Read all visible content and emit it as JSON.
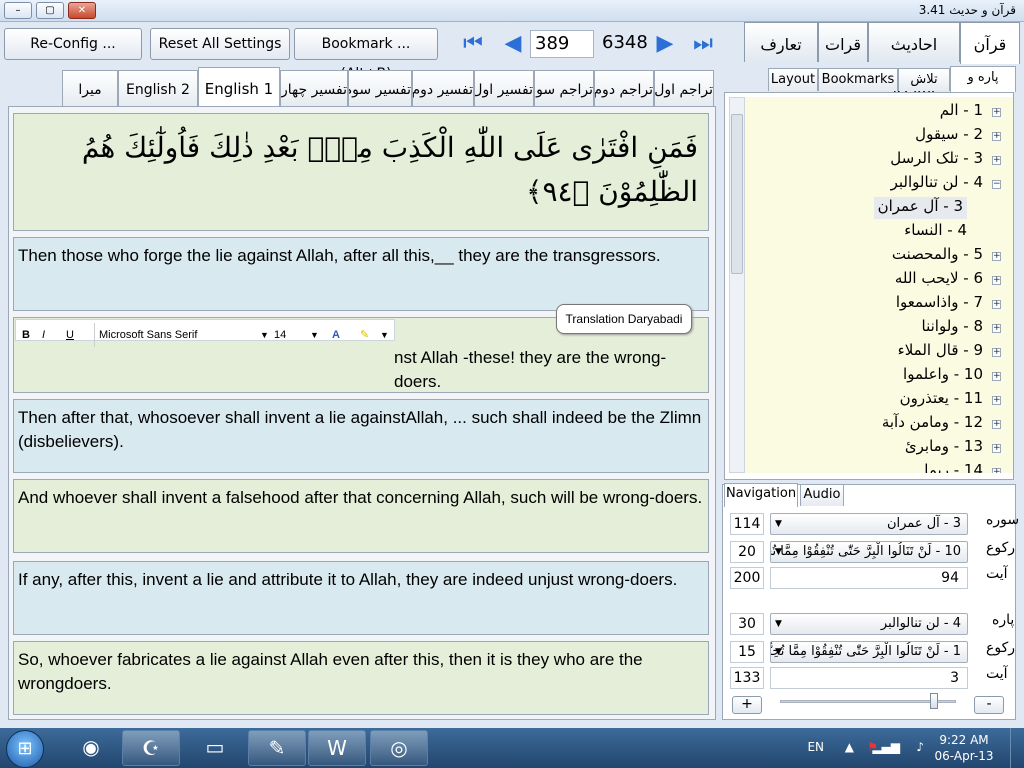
{
  "window": {
    "title": "قرآن و حديث 3.41",
    "min": "–",
    "max": "▢",
    "close": "✕"
  },
  "toolbar": {
    "reconfig": "Re-Config ...",
    "reset": "Reset All Settings ...",
    "bookmark": "Bookmark ... (Alt+B)",
    "current_verse": "389",
    "total_verses": "6348"
  },
  "main_tabs": [
    {
      "label": "قرآن مجید"
    },
    {
      "label": "احادیث مبارکه"
    },
    {
      "label": "قرات"
    },
    {
      "label": "تعارف"
    }
  ],
  "translation_tabs": [
    {
      "label": "تراجم اول"
    },
    {
      "label": "تراجم دوم"
    },
    {
      "label": "تراجم سوم"
    },
    {
      "label": "تفسير اول"
    },
    {
      "label": "تفسير دوم"
    },
    {
      "label": "تفسير سوم"
    },
    {
      "label": "تفسير چهارم"
    },
    {
      "label": "English 1"
    },
    {
      "label": "English 2"
    },
    {
      "label": "ميرا"
    }
  ],
  "verse": {
    "arabic": "فَمَنِ افْتَرٰى عَلَى اللّٰهِ الْكَذِبَ مِنْۢ بَعْدِ ذٰلِكَ فَاُولٰٓئِكَ هُمُ الظّٰلِمُوْنَ ﴿٩٤﴾",
    "translations": [
      "Then those who forge the lie against Allah, after all this,__ they are the transgressors.",
      "nst Allah -these! they are the wrong-doers.",
      "Then after that, whosoever shall invent a lie againstAllah, ... such shall indeed be the Zlimn (disbelievers).",
      "And whoever shall invent a falsehood after that concerning Allah, such will be wrong-doers.",
      "If any, after this, invent a lie and attribute it to Allah, they are indeed unjust wrong-doers.",
      "So, whoever fabricates a lie against Allah even after this, then it is they who are the wrongdoers."
    ]
  },
  "format_bar": {
    "bold": "B",
    "italic": "I",
    "underline": "U",
    "font": "Microsoft Sans Serif",
    "size": "14"
  },
  "tooltip": "Translation Daryabadi",
  "side_tabs": [
    {
      "label": "پاره و سوره"
    },
    {
      "label": "تلاش"
    },
    {
      "label": "Bookmarks"
    },
    {
      "label": "Layout"
    }
  ],
  "tree": [
    {
      "label": "1 - الم",
      "level": 0
    },
    {
      "label": "2 - سيقول",
      "level": 0
    },
    {
      "label": "3 - تلک الرسل",
      "level": 0
    },
    {
      "label": "4 - لن تنالوالبر",
      "level": 0
    },
    {
      "label": "3 - آل عمران",
      "level": 1,
      "selected": true
    },
    {
      "label": "4 - النساء",
      "level": 1
    },
    {
      "label": "5 - والمحصنت",
      "level": 0
    },
    {
      "label": "6 - لايحب الله",
      "level": 0
    },
    {
      "label": "7 - واذاسمعوا",
      "level": 0
    },
    {
      "label": "8 - ولواننا",
      "level": 0
    },
    {
      "label": "9 - قال الملاء",
      "level": 0
    },
    {
      "label": "10 - واعلموا",
      "level": 0
    },
    {
      "label": "11 - يعتذرون",
      "level": 0
    },
    {
      "label": "12 - ومامن دآبة",
      "level": 0
    },
    {
      "label": "13 - ومابرئ",
      "level": 0
    },
    {
      "label": "14 - ربما",
      "level": 0
    }
  ],
  "nav_tabs": [
    {
      "label": "Navigation"
    },
    {
      "label": "Audio"
    }
  ],
  "navigation": {
    "surah_label": "سوره",
    "ruku_label": "رکوع",
    "ayat_label": "آيت",
    "para_label": "پاره",
    "surah_count": "114",
    "surah_value": "3 - آل عمران",
    "ruku_count": "20",
    "ruku_value": "10 - لَنْ تَنَالُوا الْبِرَّ حَتّٰى تُنْفِقُوْا مِمَّا تُحِبُّوْنَ",
    "ayat_count": "200",
    "ayat_value": "94",
    "para_count": "30",
    "para_value": "4 - لن تنالوالبر",
    "para_ruku_count": "15",
    "para_ruku_value": "1 - لَنْ تَنَالُوا الْبِرَّ حَتّٰى تُنْفِقُوْا مِمَّا تُحِبُّوْنَ",
    "para_ayat_count": "133",
    "para_ayat_value": "3",
    "plus": "+",
    "minus": "-",
    "slider_level": 0.85
  },
  "taskbar": {
    "lang": "EN",
    "time": "9:22 AM",
    "date": "06-Apr-13"
  },
  "colors": {
    "verse_green": "#e5eed8",
    "verse_blue": "#d8e9f0",
    "tree_bg": "#fbfbe2",
    "accent": "#2d6fd6"
  }
}
